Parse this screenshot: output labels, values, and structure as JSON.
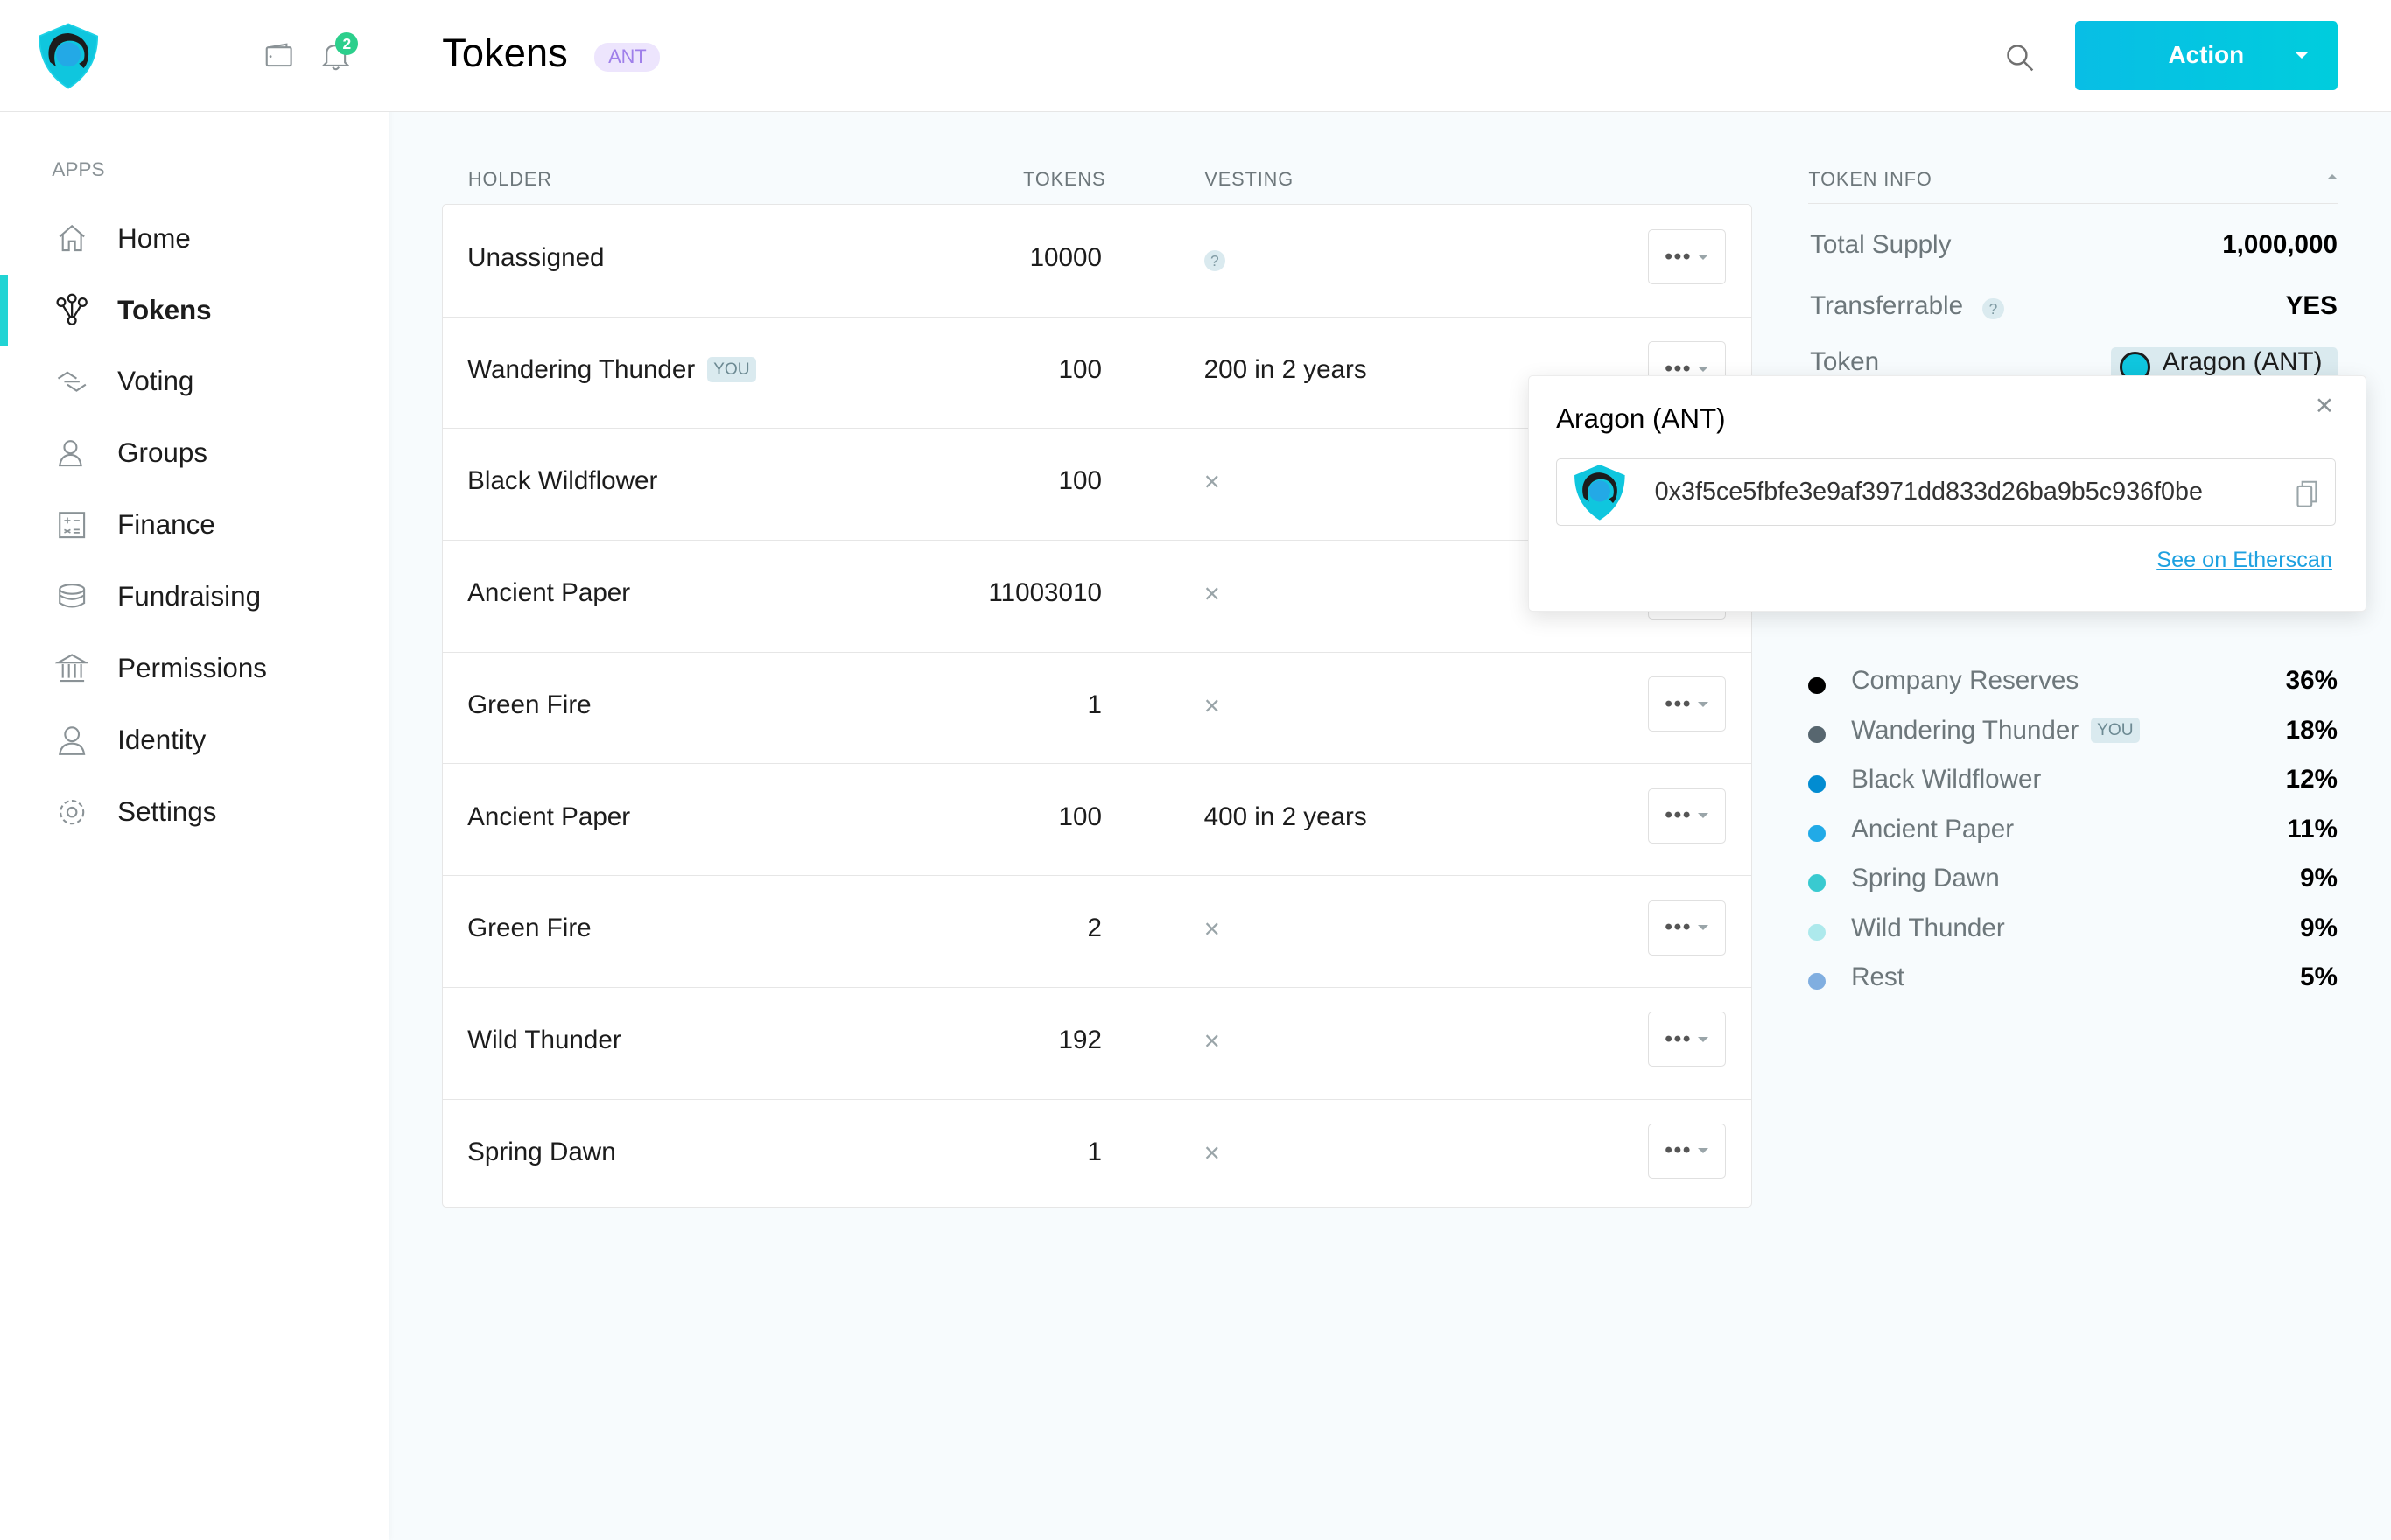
{
  "sidebar": {
    "notifications_count": "2",
    "section_label": "APPS",
    "items": [
      {
        "label": "Home",
        "icon": "home-icon"
      },
      {
        "label": "Tokens",
        "icon": "tokens-icon",
        "active": true
      },
      {
        "label": "Voting",
        "icon": "voting-icon"
      },
      {
        "label": "Groups",
        "icon": "groups-icon"
      },
      {
        "label": "Finance",
        "icon": "finance-icon"
      },
      {
        "label": "Fundraising",
        "icon": "fundraising-icon"
      },
      {
        "label": "Permissions",
        "icon": "permissions-icon"
      },
      {
        "label": "Identity",
        "icon": "identity-icon"
      },
      {
        "label": "Settings",
        "icon": "settings-icon"
      }
    ]
  },
  "header": {
    "title": "Tokens",
    "badge": "ANT",
    "action_label": "Action",
    "accent": "#08bee5"
  },
  "table": {
    "columns": [
      "HOLDER",
      "TOKENS",
      "VESTING"
    ],
    "you_label": "YOU",
    "rows": [
      {
        "holder": "Unassigned",
        "tokens": "10000",
        "vesting": "?"
      },
      {
        "holder": "Wandering Thunder",
        "you": true,
        "tokens": "100",
        "vesting": "200 in 2 years"
      },
      {
        "holder": "Black Wildflower",
        "tokens": "100",
        "vesting": "×"
      },
      {
        "holder": "Ancient Paper",
        "tokens": "11003010",
        "vesting": "×"
      },
      {
        "holder": "Green Fire",
        "tokens": "1",
        "vesting": "×"
      },
      {
        "holder": "Ancient Paper",
        "tokens": "100",
        "vesting": "400 in 2 years"
      },
      {
        "holder": "Green Fire",
        "tokens": "2",
        "vesting": "×"
      },
      {
        "holder": "Wild Thunder",
        "tokens": "192",
        "vesting": "×"
      },
      {
        "holder": "Spring Dawn",
        "tokens": "1",
        "vesting": "×"
      }
    ]
  },
  "token_info": {
    "heading": "TOKEN INFO",
    "total_supply_label": "Total Supply",
    "total_supply": "1,000,000",
    "transferable_label": "Transferrable",
    "transferable": "YES",
    "token_label": "Token",
    "token": "Aragon (ANT)"
  },
  "popover": {
    "title": "Aragon (ANT)",
    "address": "0x3f5ce5fbfe3e9af3971dd833d26ba9b5c936f0be",
    "link": "See on Etherscan"
  },
  "distribution": [
    {
      "name": "Company Reserves",
      "pct": "36%",
      "color": "#000000"
    },
    {
      "name": "Wandering Thunder",
      "you": true,
      "pct": "18%",
      "color": "#57666f"
    },
    {
      "name": "Black Wildflower",
      "pct": "12%",
      "color": "#028cd1"
    },
    {
      "name": "Ancient Paper",
      "pct": "11%",
      "color": "#21aae7"
    },
    {
      "name": "Spring Dawn",
      "pct": "9%",
      "color": "#39cad0"
    },
    {
      "name": "Wild Thunder",
      "pct": "9%",
      "color": "#ade9ec"
    },
    {
      "name": "Rest",
      "pct": "5%",
      "color": "#80aee0"
    }
  ]
}
